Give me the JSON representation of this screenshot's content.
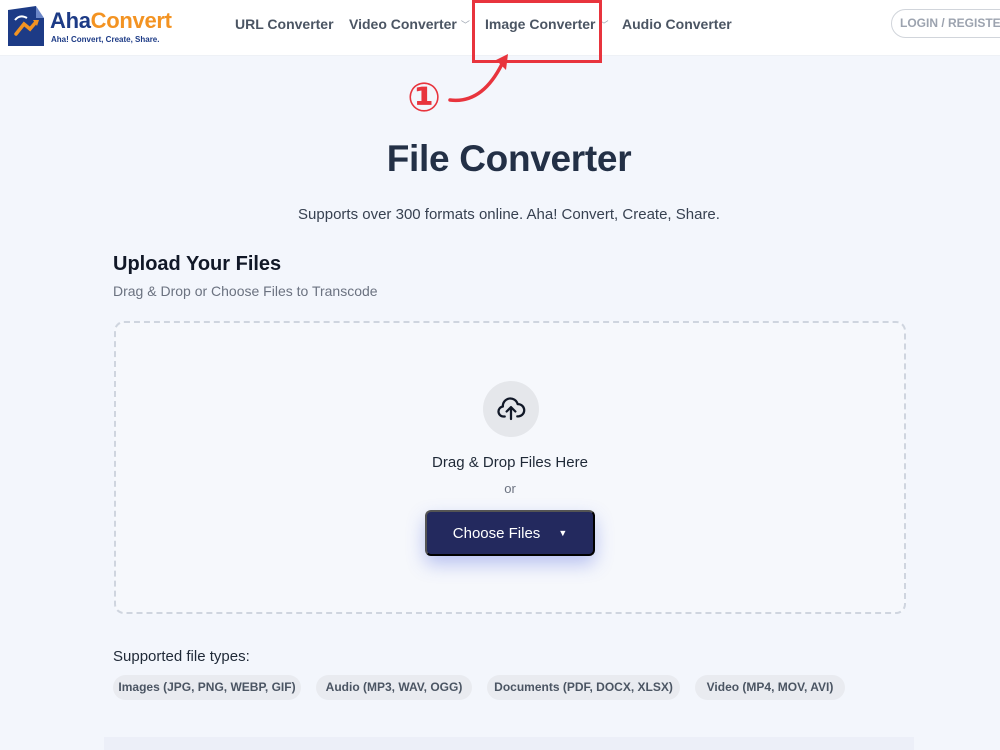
{
  "brand": {
    "name_part1": "Aha",
    "name_part2": "Convert",
    "tagline": "Aha! Convert, Create, Share.",
    "color_primary": "#1d3b86",
    "color_accent": "#f39322"
  },
  "nav": {
    "items": [
      {
        "label": "URL Converter",
        "dropdown": false
      },
      {
        "label": "Video Converter",
        "dropdown": true
      },
      {
        "label": "Image Converter",
        "dropdown": true
      },
      {
        "label": "Audio Converter",
        "dropdown": false
      }
    ],
    "login_label": "LOGIN / REGISTER"
  },
  "annotation": {
    "step": "①",
    "color": "#e8343d"
  },
  "hero": {
    "title": "File Converter",
    "subtitle": "Supports over 300 formats online. Aha! Convert, Create, Share."
  },
  "upload": {
    "heading": "Upload Your Files",
    "subheading": "Drag & Drop or Choose Files to Transcode",
    "drop_text": "Drag & Drop Files Here",
    "or_text": "or",
    "choose_label": "Choose Files",
    "button_color": "#23295e",
    "icon": "cloud-upload-icon"
  },
  "supported": {
    "label": "Supported file types:",
    "types": [
      "Images (JPG, PNG, WEBP, GIF)",
      "Audio (MP3, WAV, OGG)",
      "Documents (PDF, DOCX, XLSX)",
      "Video (MP4, MOV, AVI)"
    ]
  }
}
